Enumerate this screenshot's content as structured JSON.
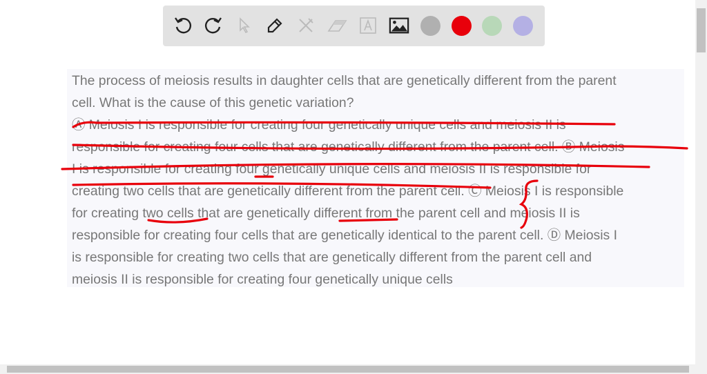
{
  "toolbar": {
    "tools": [
      "undo-icon",
      "redo-icon",
      "select-icon",
      "pen-icon",
      "tools-icon",
      "eraser-icon",
      "text-icon",
      "image-icon"
    ],
    "colors": [
      "#b0b0b0",
      "#e8000b",
      "#b8d8b8",
      "#b4b0e4"
    ]
  },
  "question": {
    "lines": [
      "The process of meiosis results in daughter cells that are genetically different from the parent",
      "cell. What is the cause of this genetic variation?",
      "Ⓐ Meiosis I is responsible for creating four genetically unique cells and meiosis II is",
      "responsible for creating four cells that are genetically different from the parent cell. Ⓑ Meiosis",
      "I is responsible for creating four genetically unique cells and meiosis II is responsible for",
      "creating two cells that are genetically different from the parent cell. Ⓒ Meiosis I is responsible",
      "for creating two cells that are genetically different from the parent cell and meiosis II is",
      "responsible for creating four cells that are genetically identical to the parent cell. Ⓓ Meiosis I",
      "is responsible for creating two cells that are genetically different from the parent cell and",
      "meiosis II is responsible for creating four genetically unique cells"
    ]
  },
  "ink_color": "#e8000b"
}
